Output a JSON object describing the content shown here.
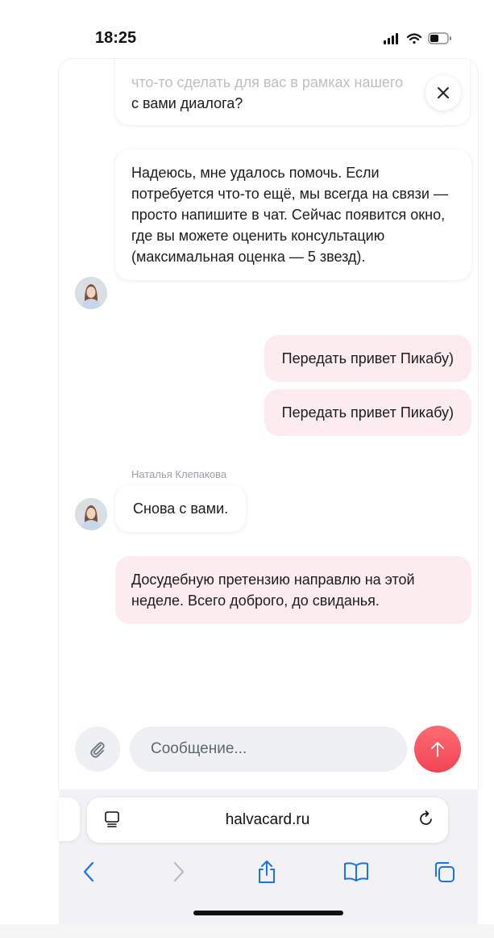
{
  "status_bar": {
    "time": "18:25"
  },
  "chat": {
    "cut_message": {
      "line1": "что-то сделать для вас в рамках нашего",
      "line2": "с вами диалога?"
    },
    "messages": [
      {
        "id": "help",
        "text": "Надеюсь, мне удалось помочь. Если потребуется что-то ещё, мы всегда на связи — просто напишите в чат. Сейчас появится окно, где вы можете оценить консультацию (максимальная оценка — 5 звезд)."
      },
      {
        "id": "out1",
        "text": "Передать привет Пикабу)"
      },
      {
        "id": "out2",
        "text": "Передать привет Пикабу)"
      },
      {
        "id": "again",
        "text": "Снова с вами."
      },
      {
        "id": "out3",
        "text": "Досудебную претензию направлю на этой неделе. Всего доброго, до свиданья."
      }
    ],
    "sender_name": "Наталья Клепакова",
    "input_placeholder": "Сообщение...",
    "colors": {
      "send": "#f04455",
      "outgoing_bubble": "#fdecef"
    }
  },
  "browser": {
    "url": "halvacard.ru"
  }
}
